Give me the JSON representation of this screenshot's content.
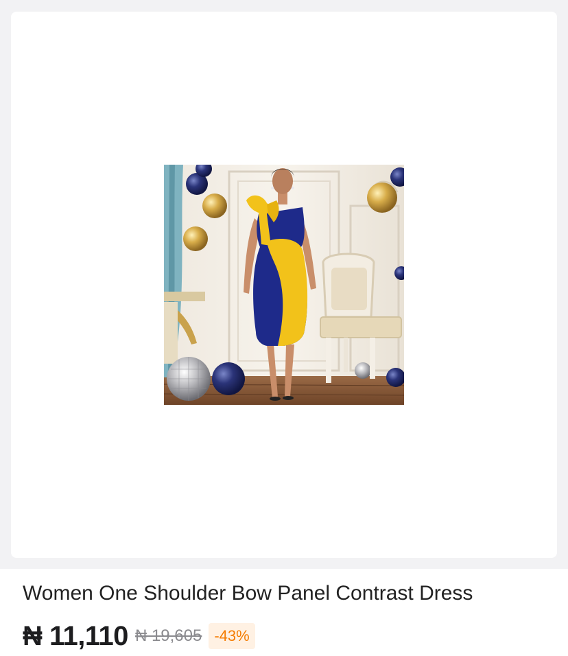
{
  "product": {
    "title": "Women One Shoulder Bow Panel Contrast Dress",
    "price": "₦ 11,110",
    "original_price": "₦ 19,605",
    "discount": "-43%"
  },
  "colors": {
    "accent_orange": "#f57c00",
    "dress_navy": "#1e2a8a",
    "dress_yellow": "#f2c21a"
  }
}
